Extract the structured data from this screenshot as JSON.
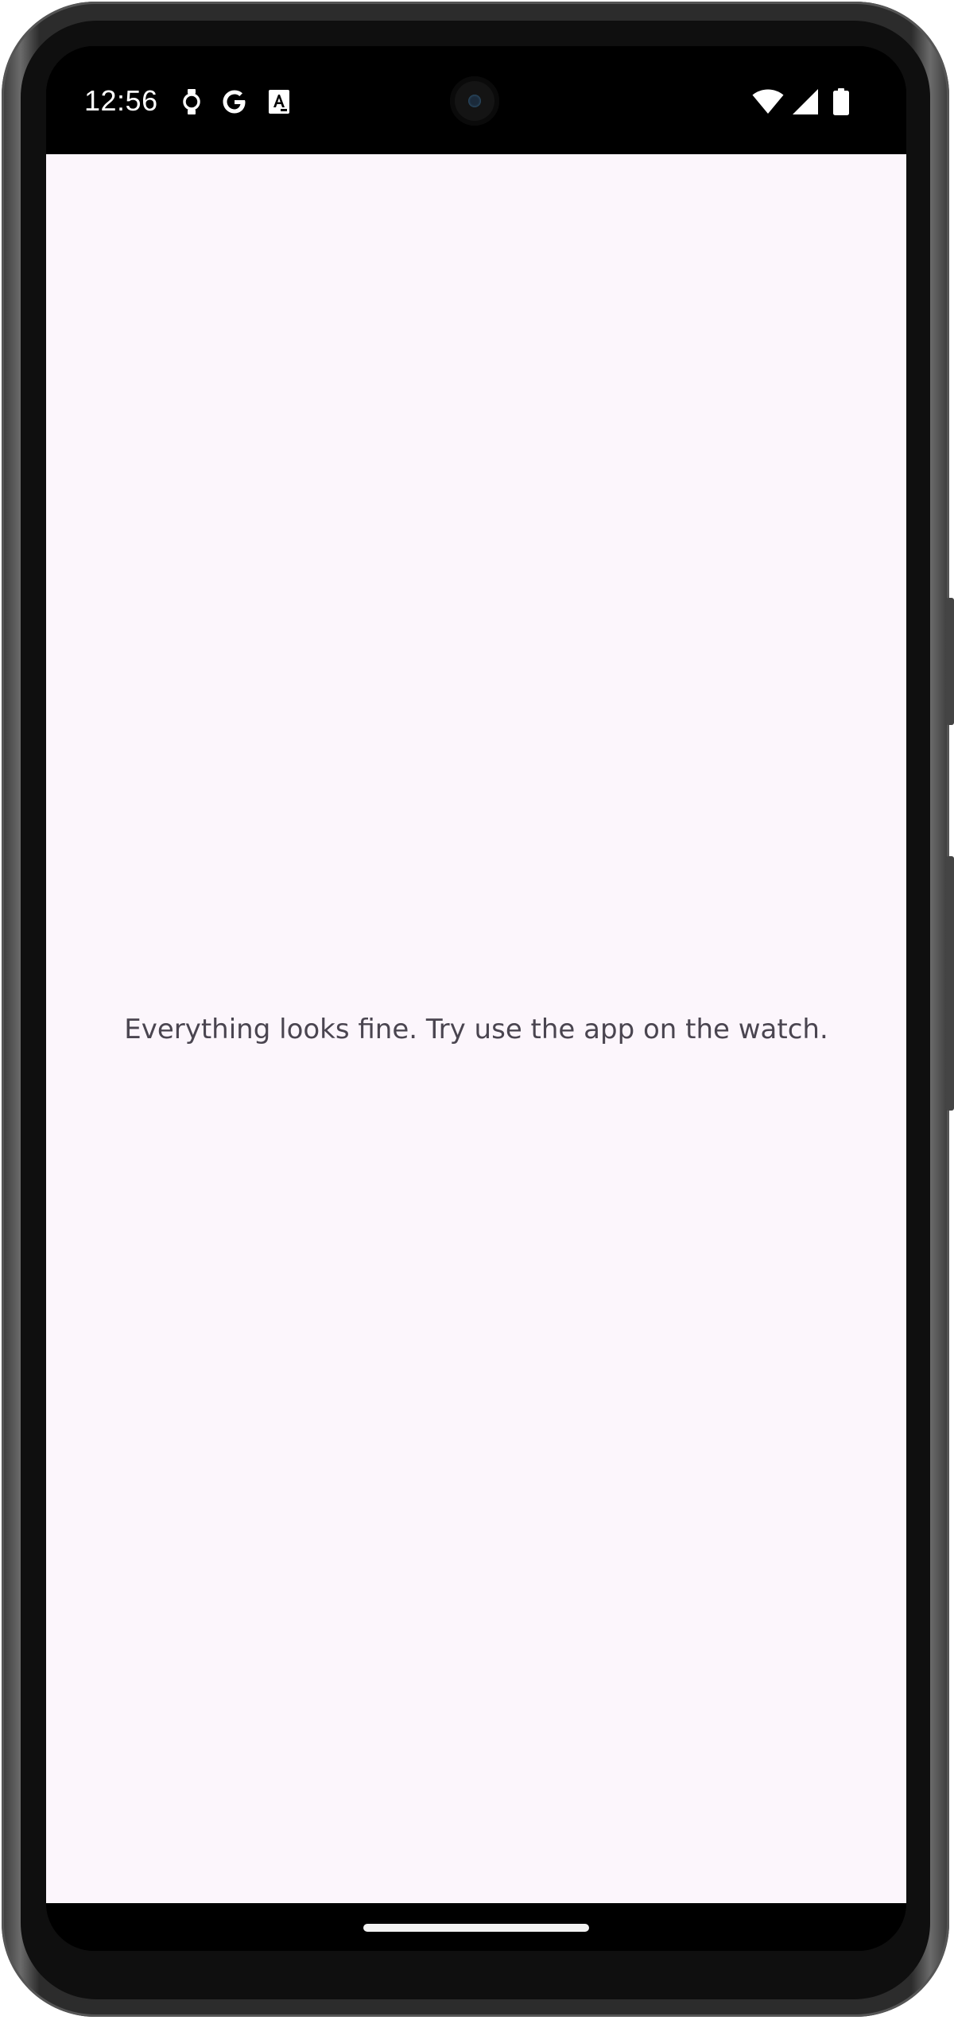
{
  "status_bar": {
    "time": "12:56",
    "left_icons": [
      "watch-icon",
      "google-icon",
      "font-app-icon"
    ],
    "right_icons": [
      "wifi-icon",
      "cellular-signal-icon",
      "battery-icon"
    ]
  },
  "app": {
    "background_color": "#fcf6fc",
    "message": "Everything looks fine. Try use the app on the watch."
  },
  "navigation": {
    "gesture_handle": "home-gesture-handle"
  }
}
